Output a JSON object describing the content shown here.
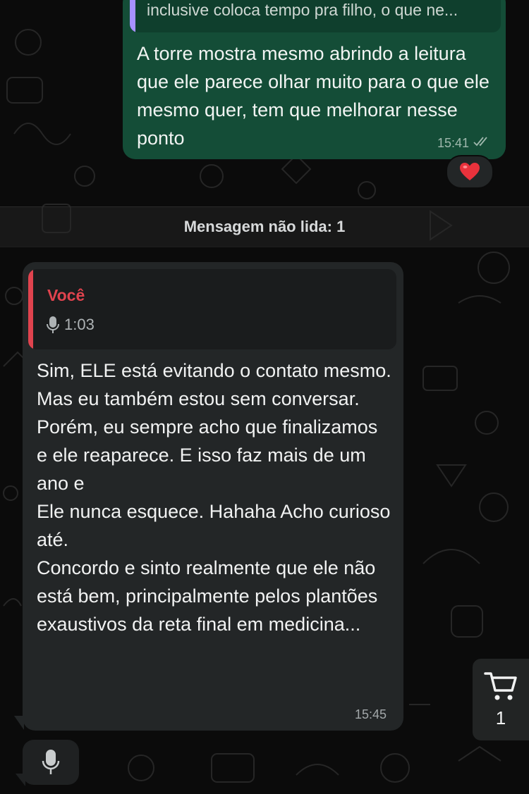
{
  "conversation": {
    "outgoing": {
      "quoted_text": "inclusive coloca tempo pra filho, o que ne...",
      "text": "A torre mostra mesmo abrindo a leitura que ele parece olhar muito para o que ele mesmo quer, tem que melhorar nesse ponto",
      "time": "15:41",
      "status_icon": "double-check-icon",
      "reaction": "heart-emoji"
    },
    "unread_divider": "Mensagem não lida: 1",
    "incoming": {
      "reply_author": "Você",
      "reply_voice_duration": "1:03",
      "text": "Sim, ELE está evitando o contato mesmo.\nMas eu também estou sem conversar.\nPorém, eu sempre acho que finalizamos e ele reaparece. E isso faz mais de um ano e\nEle nunca esquece. Hahaha Acho curioso até.\nConcordo e sinto realmente que ele não está bem, principalmente pelos plantões exaustivos da reta final em medicina...",
      "time": "15:45"
    }
  },
  "cart": {
    "count": "1"
  },
  "colors": {
    "outgoing_bubble": "#144d37",
    "incoming_bubble": "#232627",
    "reply_accent": "#e0434e",
    "outgoing_quote_accent": "#a791ff"
  }
}
